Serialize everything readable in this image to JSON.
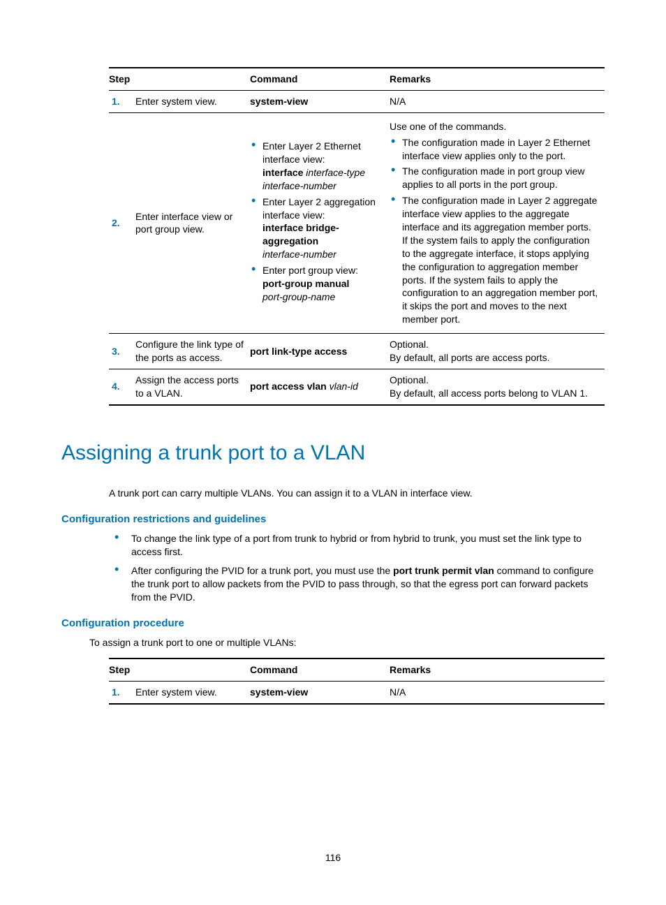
{
  "table1": {
    "headers": {
      "step": "Step",
      "command": "Command",
      "remarks": "Remarks"
    },
    "rows": [
      {
        "num": "1.",
        "step": "Enter system view.",
        "cmd": "system-view",
        "remarks": "N/A"
      },
      {
        "num": "2.",
        "step": "Enter interface view or port group view.",
        "cmd_items": [
          {
            "before": "Enter Layer 2 Ethernet interface view:",
            "bold": "interface",
            "italic": "interface-type interface-number"
          },
          {
            "before": "Enter Layer 2 aggregation interface view:",
            "bold": "interface bridge-aggregation",
            "italic": "interface-number"
          },
          {
            "before": "Enter port group view:",
            "bold": "port-group manual",
            "italic": "port-group-name"
          }
        ],
        "remarks_intro": "Use one of the commands.",
        "remarks_items": [
          "The configuration made in Layer 2 Ethernet interface view applies only to the port.",
          "The configuration made in port group view applies to all ports in the port group.",
          "The configuration made in Layer 2 aggregate interface view applies to the aggregate interface and its aggregation member ports. If the system fails to apply the configuration to the aggregate interface, it stops applying the configuration to aggregation member ports. If the system fails to apply the configuration to an aggregation member port, it skips the port and moves to the next member port."
        ]
      },
      {
        "num": "3.",
        "step": "Configure the link type of the ports as access.",
        "cmd": "port link-type access",
        "remarks_line1": "Optional.",
        "remarks_line2": "By default, all ports are access ports."
      },
      {
        "num": "4.",
        "step": "Assign the access ports to a VLAN.",
        "cmd_bold": "port access vlan",
        "cmd_italic": "vlan-id",
        "remarks_line1": "Optional.",
        "remarks_line2": "By default, all access ports belong to VLAN 1."
      }
    ]
  },
  "heading": "Assigning a trunk port to a VLAN",
  "body1": "A trunk port can carry multiple VLANs. You can assign it to a VLAN in interface view.",
  "sub1": "Configuration restrictions and guidelines",
  "guidelines": [
    {
      "text": "To change the link type of a port from trunk to hybrid or from hybrid to trunk, you must set the link type to access first."
    },
    {
      "text_before": "After configuring the PVID for a trunk port, you must use the ",
      "bold": "port trunk permit vlan",
      "text_after": " command to configure the trunk port to allow packets from the PVID to pass through, so that the egress port can forward packets from the PVID."
    }
  ],
  "sub2": "Configuration procedure",
  "intro2": "To assign a trunk port to one or multiple VLANs:",
  "table2": {
    "headers": {
      "step": "Step",
      "command": "Command",
      "remarks": "Remarks"
    },
    "rows": [
      {
        "num": "1.",
        "step": "Enter system view.",
        "cmd": "system-view",
        "remarks": "N/A"
      }
    ]
  },
  "page": "116"
}
